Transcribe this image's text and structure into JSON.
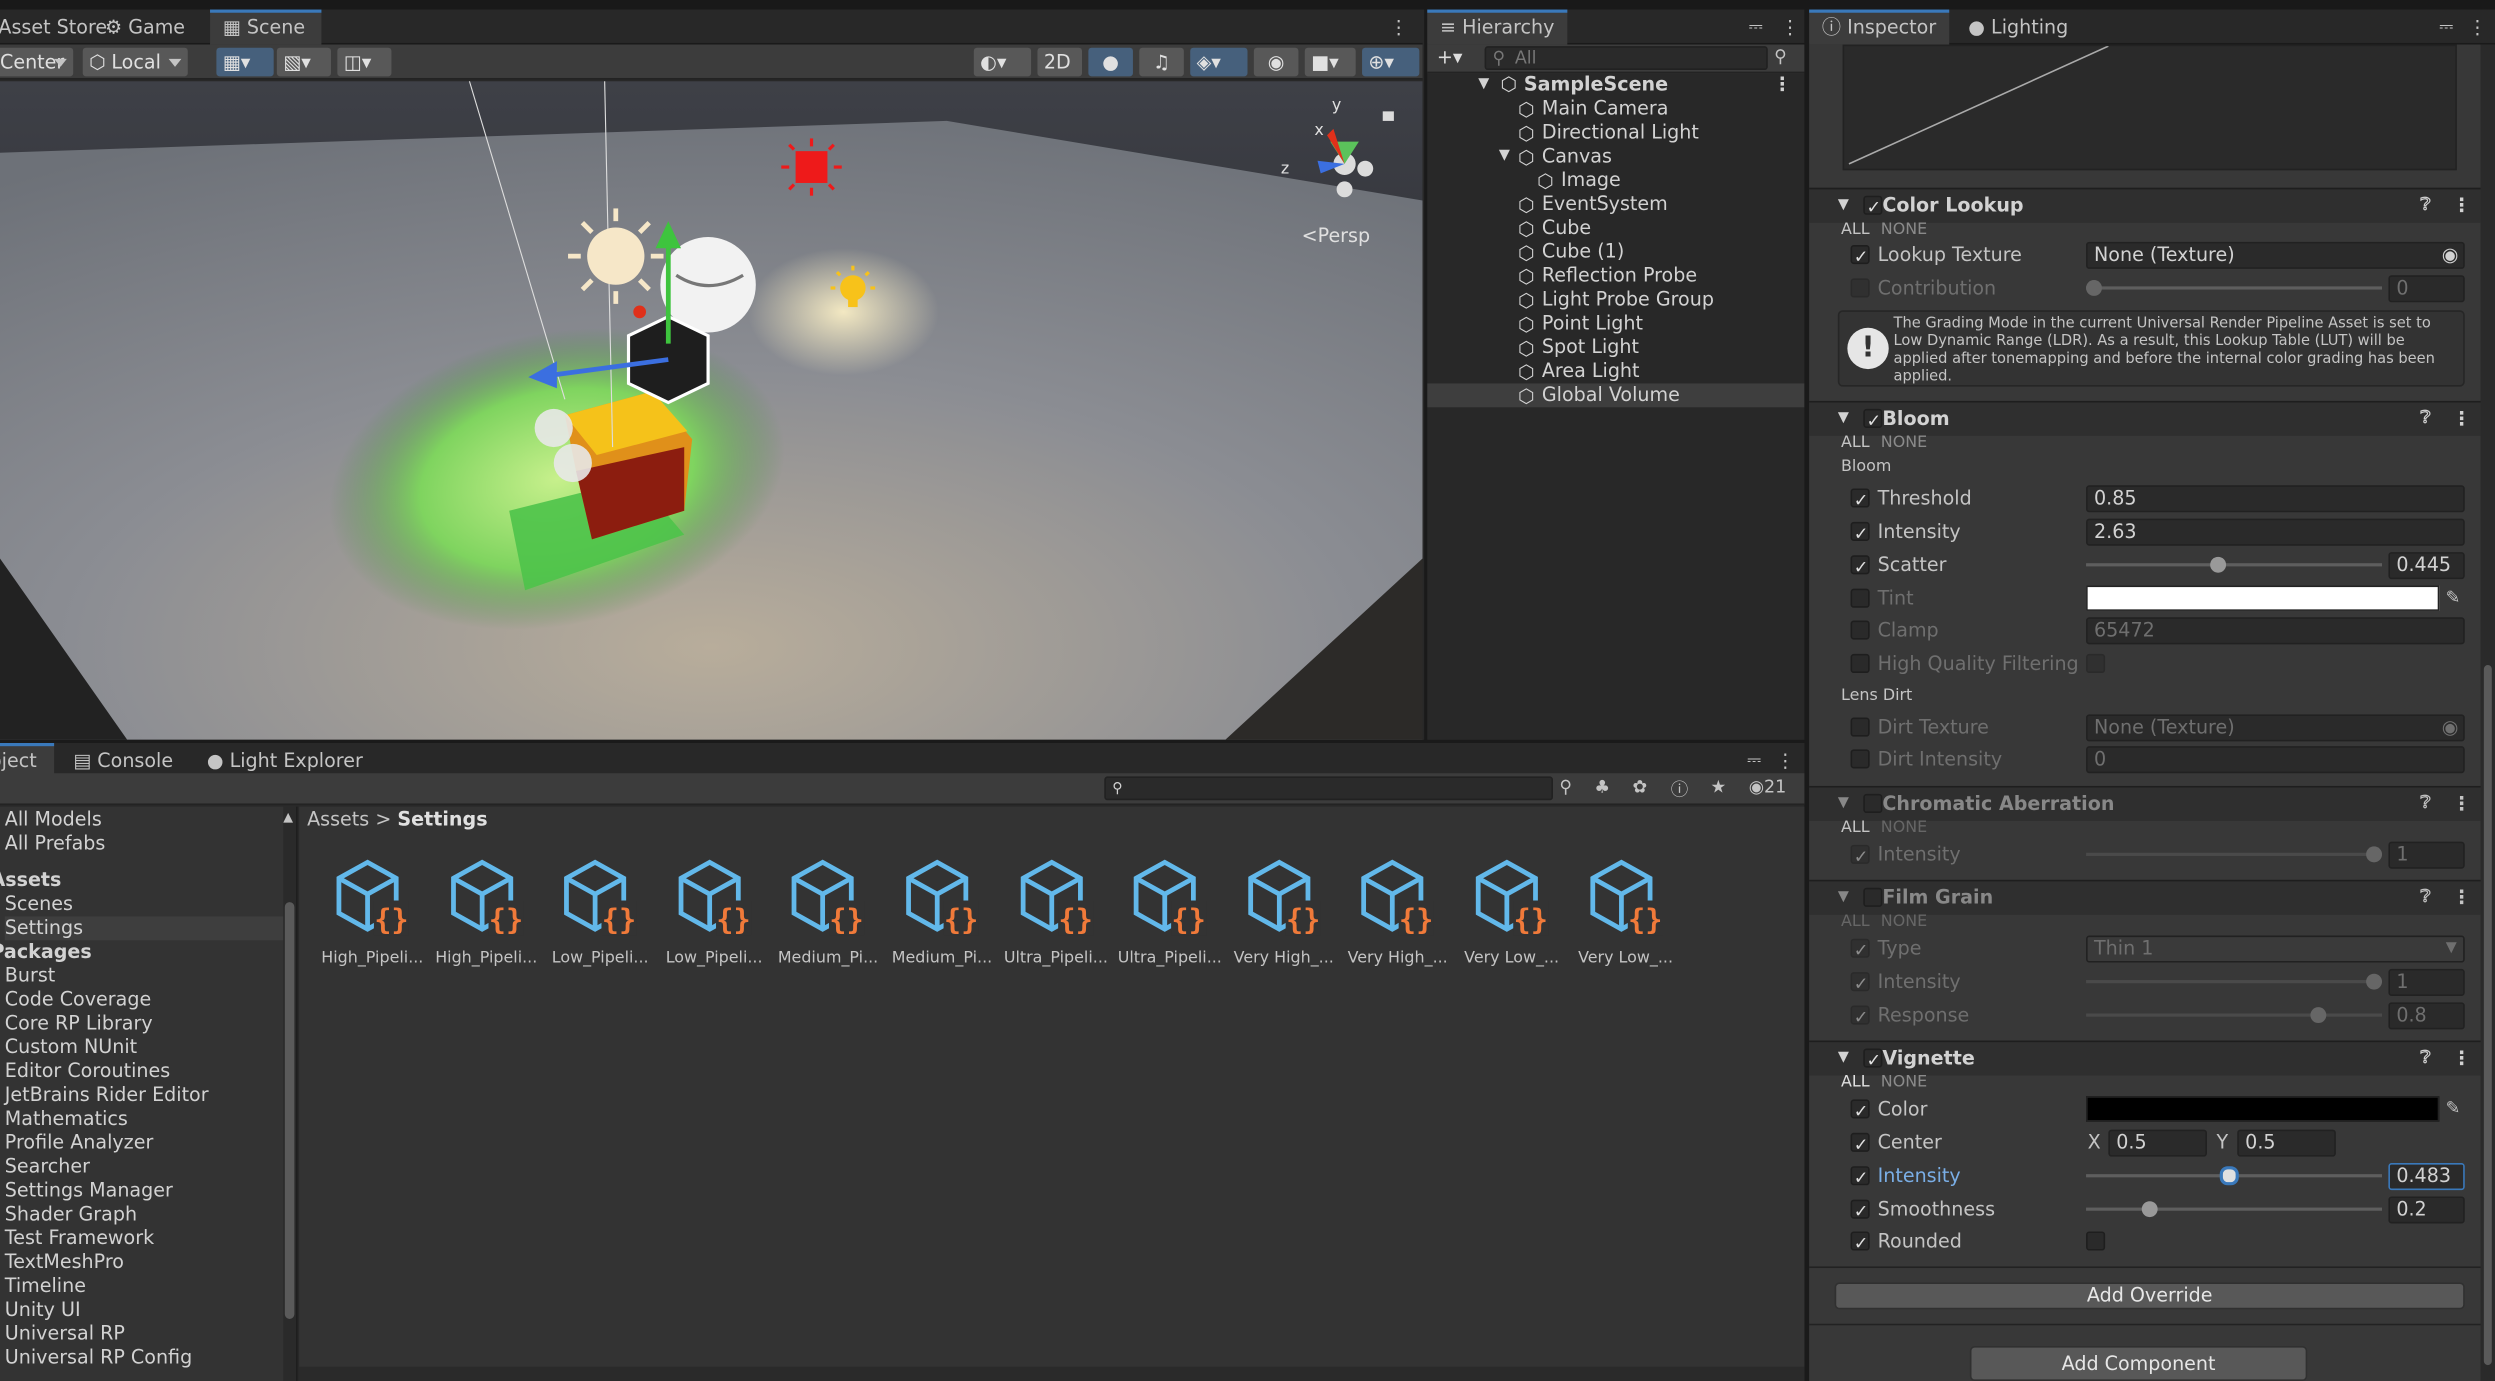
{
  "scene_tabs": [
    "Asset Store",
    "Game",
    "Scene"
  ],
  "scene_toolbar": {
    "pivot": "Center",
    "space": "Local",
    "mode_2d": "2D",
    "persp": "Persp"
  },
  "gizmo_axes": {
    "y": "y",
    "x": "x",
    "z": "z"
  },
  "hierarchy": {
    "title": "Hierarchy",
    "search_placeholder": "All",
    "scene": "SampleScene",
    "items": [
      "Main Camera",
      "Directional Light",
      "Canvas",
      "Image",
      "EventSystem",
      "Cube",
      "Cube (1)",
      "Reflection Probe",
      "Light Probe Group",
      "Point Light",
      "Spot Light",
      "Area Light",
      "Global Volume"
    ]
  },
  "inspector": {
    "tabs": [
      "Inspector",
      "Lighting"
    ],
    "color_lookup": {
      "title": "Color Lookup",
      "all": "ALL",
      "none": "NONE",
      "lookup_texture_label": "Lookup Texture",
      "lookup_texture_value": "None (Texture)",
      "contribution_label": "Contribution",
      "contribution_value": "0",
      "contribution": 0,
      "warning": "The Grading Mode in the current Universal Render Pipeline Asset is set to Low Dynamic Range (LDR). As a result, this Lookup Table (LUT) will be applied after tonemapping and before the internal color grading has been applied."
    },
    "bloom": {
      "title": "Bloom",
      "all": "ALL",
      "none": "NONE",
      "group_bloom": "Bloom",
      "threshold_label": "Threshold",
      "threshold": "0.85",
      "intensity_label": "Intensity",
      "intensity": "2.63",
      "scatter_label": "Scatter",
      "scatter": "0.445",
      "scatter_fraction": 0.445,
      "tint_label": "Tint",
      "clamp_label": "Clamp",
      "clamp": "65472",
      "hq_label": "High Quality Filtering",
      "group_dirt": "Lens Dirt",
      "dirt_texture_label": "Dirt Texture",
      "dirt_texture": "None (Texture)",
      "dirt_intensity_label": "Dirt Intensity",
      "dirt_intensity": "0"
    },
    "chromatic": {
      "title": "Chromatic Aberration",
      "all": "ALL",
      "none": "NONE",
      "intensity_label": "Intensity",
      "intensity": "1",
      "intensity_fraction": 1
    },
    "film_grain": {
      "title": "Film Grain",
      "all": "ALL",
      "none": "NONE",
      "type_label": "Type",
      "type_value": "Thin 1",
      "intensity_label": "Intensity",
      "intensity": "1",
      "intensity_fraction": 1,
      "response_label": "Response",
      "response": "0.8",
      "response_fraction": 0.8
    },
    "vignette": {
      "title": "Vignette",
      "all": "ALL",
      "none": "NONE",
      "color_label": "Color",
      "color": "#000000",
      "center_label": "Center",
      "center_x_label": "X",
      "center_x": "0.5",
      "center_y_label": "Y",
      "center_y": "0.5",
      "intensity_label": "Intensity",
      "intensity": "0.483",
      "intensity_fraction": 0.483,
      "smoothness_label": "Smoothness",
      "smoothness": "0.2",
      "smoothness_fraction": 0.2,
      "rounded_label": "Rounded"
    },
    "add_override": "Add Override",
    "add_component": "Add Component"
  },
  "bottom_tabs": [
    "Project",
    "Console",
    "Light Explorer"
  ],
  "project": {
    "visible_count": "21",
    "tree": [
      {
        "t": "All Models",
        "k": ""
      },
      {
        "t": "All Prefabs",
        "k": ""
      },
      {
        "t": "Assets",
        "k": "hdr"
      },
      {
        "t": "Scenes",
        "k": ""
      },
      {
        "t": "Settings",
        "k": "sel"
      },
      {
        "t": "Packages",
        "k": "hdr"
      },
      {
        "t": "Burst",
        "k": ""
      },
      {
        "t": "Code Coverage",
        "k": ""
      },
      {
        "t": "Core RP Library",
        "k": ""
      },
      {
        "t": "Custom NUnit",
        "k": ""
      },
      {
        "t": "Editor Coroutines",
        "k": ""
      },
      {
        "t": "JetBrains Rider Editor",
        "k": ""
      },
      {
        "t": "Mathematics",
        "k": ""
      },
      {
        "t": "Profile Analyzer",
        "k": ""
      },
      {
        "t": "Searcher",
        "k": ""
      },
      {
        "t": "Settings Manager",
        "k": ""
      },
      {
        "t": "Shader Graph",
        "k": ""
      },
      {
        "t": "Test Framework",
        "k": ""
      },
      {
        "t": "TextMeshPro",
        "k": ""
      },
      {
        "t": "Timeline",
        "k": ""
      },
      {
        "t": "Unity UI",
        "k": ""
      },
      {
        "t": "Universal RP",
        "k": ""
      },
      {
        "t": "Universal RP Config",
        "k": ""
      }
    ],
    "breadcrumb": [
      "Assets",
      "Settings"
    ],
    "assets": [
      "High_Pipeli...",
      "High_Pipeli...",
      "Low_Pipeli...",
      "Low_Pipeli...",
      "Medium_Pi...",
      "Medium_Pi...",
      "Ultra_Pipeli...",
      "Ultra_Pipeli...",
      "Very High_...",
      "Very High_...",
      "Very Low_...",
      "Very Low_..."
    ]
  }
}
